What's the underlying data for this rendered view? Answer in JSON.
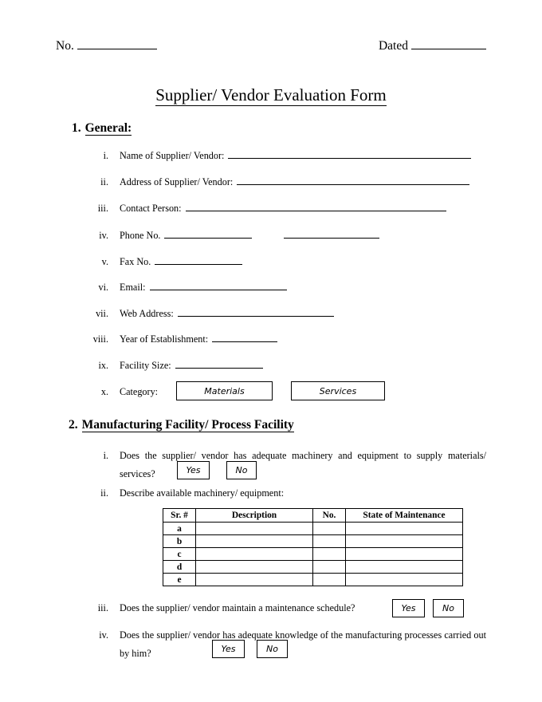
{
  "header": {
    "number_label": "No.",
    "dated_label": "Dated"
  },
  "title": "Supplier/ Vendor Evaluation Form",
  "sections": [
    {
      "number": "1.",
      "heading": "General:",
      "items": [
        {
          "rn": "i.",
          "label": "Name of Supplier/ Vendor:"
        },
        {
          "rn": "ii.",
          "label": "Address of Supplier/ Vendor:"
        },
        {
          "rn": "iii.",
          "label": "Contact Person:"
        },
        {
          "rn": "iv.",
          "label": "Phone No."
        },
        {
          "rn": "v.",
          "label": "Fax No."
        },
        {
          "rn": "vi.",
          "label": "Email:"
        },
        {
          "rn": "vii.",
          "label": "Web Address:"
        },
        {
          "rn": "viii.",
          "label": "Year of Establishment:"
        },
        {
          "rn": "ix.",
          "label": "Facility Size:"
        },
        {
          "rn": "x.",
          "label": "Category:"
        }
      ],
      "category_options": [
        "Materials",
        "Services"
      ]
    },
    {
      "number": "2.",
      "heading": "Manufacturing Facility/ Process Facility",
      "items": [
        {
          "rn": "i.",
          "question": "Does the supplier/ vendor has adequate machinery and equipment to supply materials/ services?",
          "options": [
            "Yes",
            "No"
          ]
        },
        {
          "rn": "ii.",
          "question": "Describe available machinery/ equipment:"
        },
        {
          "rn": "iii.",
          "question": "Does the supplier/ vendor maintain a maintenance schedule?",
          "options": [
            "Yes",
            "No"
          ]
        },
        {
          "rn": "iv.",
          "question": "Does the supplier/ vendor has adequate knowledge of the manufacturing processes carried out by him?",
          "options": [
            "Yes",
            "No"
          ]
        }
      ]
    }
  ],
  "equipment_table": {
    "columns": [
      "Sr. #",
      "Description",
      "No.",
      "State of Maintenance"
    ],
    "rows": [
      {
        "sr": "a",
        "description": "",
        "no": "",
        "state": ""
      },
      {
        "sr": "b",
        "description": "",
        "no": "",
        "state": ""
      },
      {
        "sr": "c",
        "description": "",
        "no": "",
        "state": ""
      },
      {
        "sr": "d",
        "description": "",
        "no": "",
        "state": ""
      },
      {
        "sr": "e",
        "description": "",
        "no": "",
        "state": ""
      }
    ]
  }
}
